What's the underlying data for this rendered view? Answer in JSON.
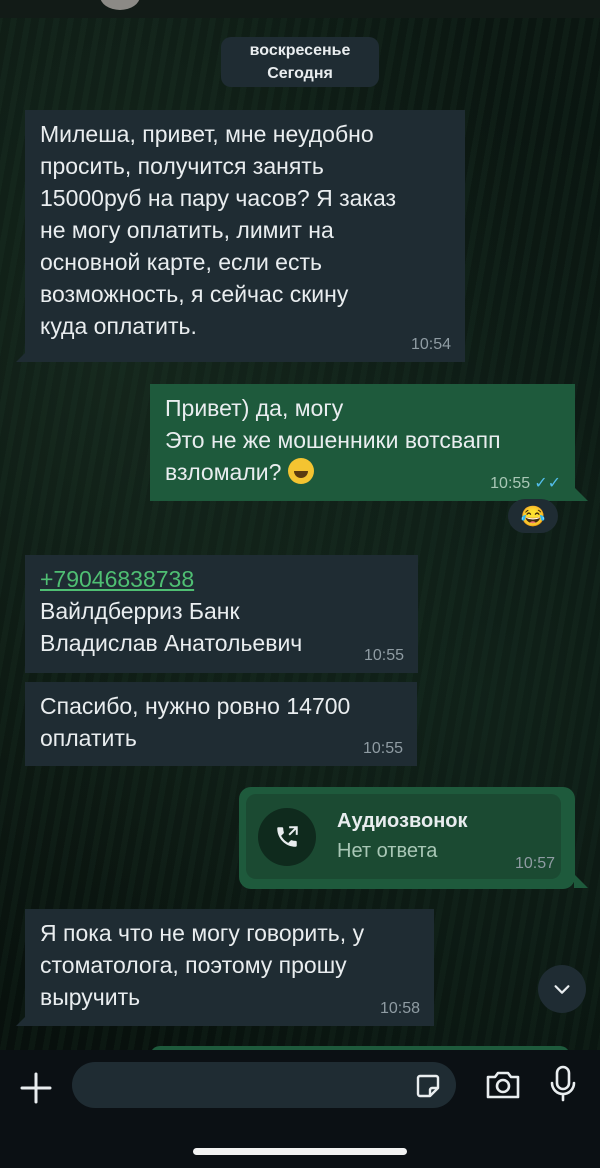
{
  "date_chip": {
    "line1": "воскресенье",
    "line2": "Сегодня"
  },
  "messages": [
    {
      "text": "Милеша, привет, мне неудобно\nпросить, получится занять\n15000руб на пару часов? Я заказ\nне могу оплатить, лимит на\nосновной карте, если есть\nвозможность, я сейчас скину\nкуда оплатить.",
      "time": "10:54"
    },
    {
      "text": "Привет) да, могу\nЭто не же мошенники вотсвапп\nвзломали?",
      "time": "10:55",
      "status": "✓✓"
    },
    {
      "link": "+79046838738",
      "text": "Вайлдберриз Банк\nВладислав Анатольевич",
      "time": "10:55"
    },
    {
      "text": "Спасибо, нужно ровно 14700\nоплатить",
      "time": "10:55"
    },
    {
      "text": "Я пока что не могу говорить, у\nстоматолога, поэтому прошу\nвыручить",
      "time": "10:58"
    }
  ],
  "reaction": "😂",
  "call": {
    "title": "Аудиозвонок",
    "subtitle": "Нет ответа",
    "time": "10:57"
  },
  "composer": {
    "placeholder": ""
  },
  "icons": [
    "plus-icon",
    "sticker-icon",
    "camera-icon",
    "microphone-icon",
    "chevron-down-icon",
    "call-outgoing-icon"
  ],
  "colors": {
    "incoming": "#1f2c33",
    "outgoing": "#1e5a3c",
    "link": "#4fbf73",
    "read_ticks": "#53bdeb"
  }
}
